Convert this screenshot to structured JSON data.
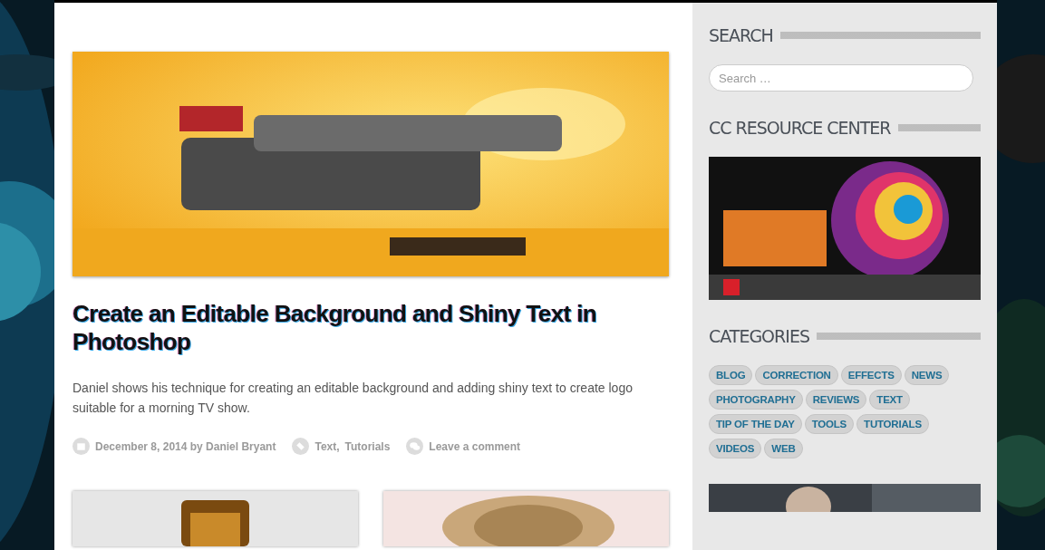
{
  "post": {
    "image": {
      "kind": "picture"
    },
    "title": "Create an Editable Background and Shiny Text in Photoshop",
    "excerpt": "Daniel shows his technique for creating an editable background and adding shiny text to create logo suitable for a morning TV show.",
    "meta": [
      {
        "kind": "date",
        "texts": [
          "December 8, 2014 by Daniel Bryant"
        ]
      },
      {
        "kind": "tags",
        "texts": [
          "Text,",
          "Tutorials"
        ]
      },
      {
        "kind": "comments",
        "texts": [
          "Leave a comment"
        ]
      }
    ]
  },
  "more_posts": [
    {
      "kind": "picture"
    },
    {
      "kind": "picture"
    }
  ],
  "sidebar": [
    {
      "kind": "search",
      "title": "SEARCH",
      "placeholder": "Search …"
    },
    {
      "kind": "banner",
      "title": "CC RESOURCE CENTER"
    },
    {
      "kind": "categories",
      "title": "CATEGORIES",
      "items": [
        "BLOG",
        "CORRECTION",
        "EFFECTS",
        "NEWS",
        "PHOTOGRAPHY",
        "REVIEWS",
        "TEXT",
        "TIP OF THE DAY",
        "TOOLS",
        "TUTORIALS",
        "VIDEOS",
        "WEB"
      ]
    },
    {
      "kind": "picture"
    }
  ]
}
